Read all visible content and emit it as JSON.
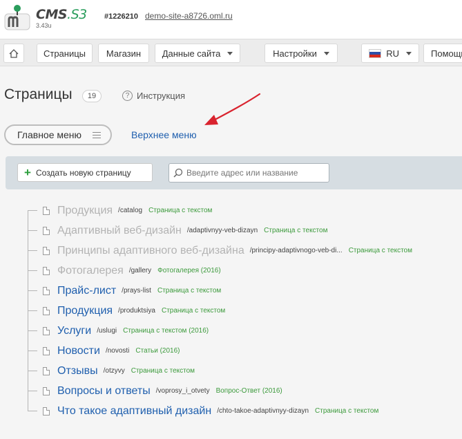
{
  "header": {
    "logo_text": "CMS",
    "logo_suffix": ".S3",
    "version": "3.43u",
    "site_id": "#1226210",
    "site_url": "demo-site-a8726.oml.ru"
  },
  "toolbar": {
    "pages": "Страницы",
    "shop": "Магазин",
    "site_data": "Данные сайта",
    "settings": "Настройки",
    "language": "RU",
    "help": "Помощь"
  },
  "title": {
    "text": "Страницы",
    "count": "19",
    "help_label": "Инструкция"
  },
  "menus": {
    "main": "Главное меню",
    "top": "Верхнее меню"
  },
  "actions": {
    "create": "Создать новую страницу",
    "search_placeholder": "Введите адрес или название"
  },
  "pages": [
    {
      "title": "Продукция",
      "url": "/catalog",
      "type": "Страница с текстом",
      "muted": true
    },
    {
      "title": "Адаптивный веб-дизайн",
      "url": "/adaptivnyy-veb-dizayn",
      "type": "Страница с текстом",
      "muted": true
    },
    {
      "title": "Принципы адаптивного веб-дизайна",
      "url": "/principy-adaptivnogo-veb-di...",
      "type": "Страница с текстом",
      "muted": true
    },
    {
      "title": "Фотогалерея",
      "url": "/gallery",
      "type": "Фотогалерея (2016)",
      "muted": true
    },
    {
      "title": "Прайс-лист",
      "url": "/prays-list",
      "type": "Страница с текстом",
      "muted": false
    },
    {
      "title": "Продукция",
      "url": "/produktsiya",
      "type": "Страница с текстом",
      "muted": false
    },
    {
      "title": "Услуги",
      "url": "/uslugi",
      "type": "Страница с текстом (2016)",
      "muted": false
    },
    {
      "title": "Новости",
      "url": "/novosti",
      "type": "Статьи (2016)",
      "muted": false
    },
    {
      "title": "Отзывы",
      "url": "/otzyvy",
      "type": "Страница с текстом",
      "muted": false
    },
    {
      "title": "Вопросы и ответы",
      "url": "/voprosy_i_otvety",
      "type": "Вопрос-Ответ (2016)",
      "muted": false
    },
    {
      "title": "Что такое адаптивный дизайн",
      "url": "/chto-takoe-adaptivnyy-dizayn",
      "type": "Страница с текстом",
      "muted": false
    }
  ],
  "colors": {
    "link": "#1f5fae",
    "muted": "#b3b3b3",
    "type_green": "#3c9a3c",
    "arrow_red": "#d9232e",
    "logo_green": "#2a9d5c"
  }
}
